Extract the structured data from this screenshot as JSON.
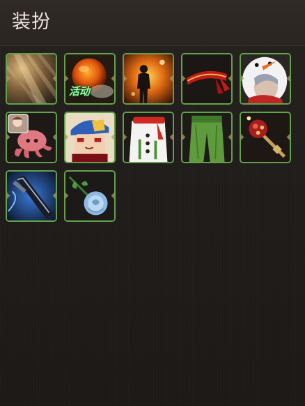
{
  "panel": {
    "title": "装扮"
  },
  "items": [
    {
      "icon": "light-rays-icon",
      "badge": ""
    },
    {
      "icon": "orange-orb-icon",
      "badge": "活动"
    },
    {
      "icon": "fire-silhouette-icon",
      "badge": ""
    },
    {
      "icon": "red-headband-icon",
      "badge": ""
    },
    {
      "icon": "snowman-hood-character-icon",
      "badge": ""
    },
    {
      "icon": "octopus-pet-icon",
      "badge": ""
    },
    {
      "icon": "blue-cap-character-icon",
      "badge": ""
    },
    {
      "icon": "snowman-coat-icon",
      "badge": ""
    },
    {
      "icon": "green-pants-icon",
      "badge": ""
    },
    {
      "icon": "red-mace-icon",
      "badge": ""
    },
    {
      "icon": "dark-blade-icon",
      "badge": ""
    },
    {
      "icon": "blue-rose-icon",
      "badge": ""
    }
  ],
  "colors": {
    "slot_border": "#63a24a",
    "badge_text": "#9dfaa9"
  }
}
